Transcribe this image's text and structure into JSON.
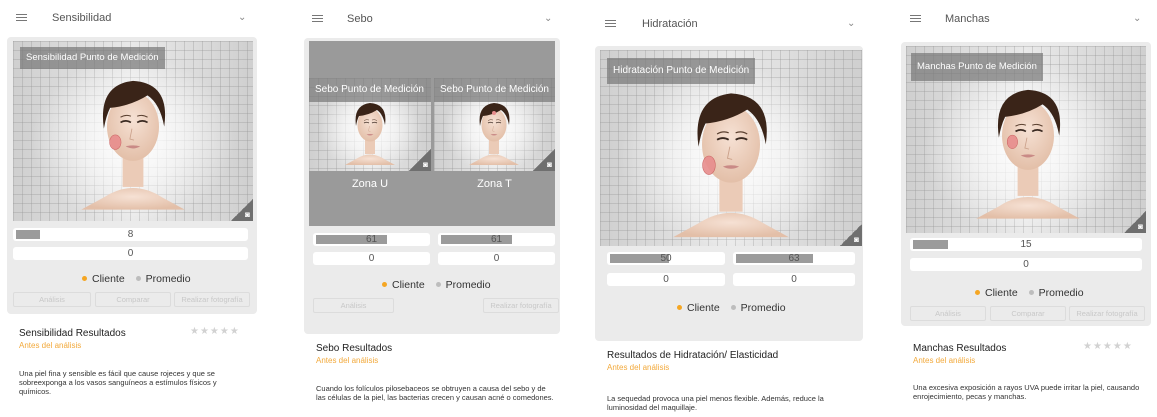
{
  "colors": {
    "accent": "#f5a623",
    "promedio": "#bdbdbd"
  },
  "icons": {
    "menu": "hamburger-icon",
    "dropdown": "chevron-down-icon",
    "camera": "camera-icon"
  },
  "legend": {
    "cliente": "Cliente",
    "promedio": "Promedio"
  },
  "panels": [
    {
      "header": "Sensibilidad",
      "photo_label": "Sensibilidad Punto de Medición",
      "cliente_value": "8",
      "cliente_fraction": 0.1,
      "promedio_value": "0",
      "buttons": [
        "Análisis",
        "Comparar",
        "Realizar fotografía"
      ],
      "result_title": "Sensibilidad Resultados",
      "result_sub": "Antes del análisis",
      "stars": "★★★★★",
      "description": "Una piel fina y sensible es fácil que cause rojeces y que se sobreexponga a los vasos sanguíneos a estímulos físicos y químicos."
    },
    {
      "header": "Sebo",
      "zones": [
        {
          "label": "Sebo Punto de Medición",
          "name": "Zona U",
          "cliente_value": "61",
          "cliente_fraction": 0.61,
          "promedio_value": "0"
        },
        {
          "label": "Sebo Punto de Medición",
          "name": "Zona T",
          "cliente_value": "61",
          "cliente_fraction": 0.61,
          "promedio_value": "0"
        }
      ],
      "buttons": [
        "Análisis",
        "Realizar fotografía"
      ],
      "result_title": "Sebo Resultados",
      "result_sub": "Antes del análisis",
      "description": "Cuando los folículos pilosebaceos se obtruyen a causa del sebo y de las células de la piel, las bacterias crecen y causan acné o comedones."
    },
    {
      "header": "Hidratación",
      "photo_label": "Hidratación Punto de Medición",
      "values": [
        {
          "cliente_value": "50",
          "cliente_fraction": 0.5,
          "promedio_value": "0"
        },
        {
          "cliente_value": "63",
          "cliente_fraction": 0.63,
          "promedio_value": "0"
        }
      ],
      "result_title": "Resultados de Hidratación/ Elasticidad",
      "result_sub": "Antes del análisis",
      "description": "La sequedad provoca una piel menos flexible. Además, reduce la luminosidad del maquillaje."
    },
    {
      "header": "Manchas",
      "photo_label": "Manchas Punto de Medición",
      "cliente_value": "15",
      "cliente_fraction": 0.15,
      "promedio_value": "0",
      "buttons": [
        "Análisis",
        "Comparar",
        "Realizar fotografía"
      ],
      "result_title": "Manchas Resultados",
      "result_sub": "Antes del análisis",
      "stars": "★★★★★",
      "description": "Una excesiva exposición a rayos UVA puede irritar la piel, causando enrojecimiento, pecas y manchas."
    }
  ]
}
